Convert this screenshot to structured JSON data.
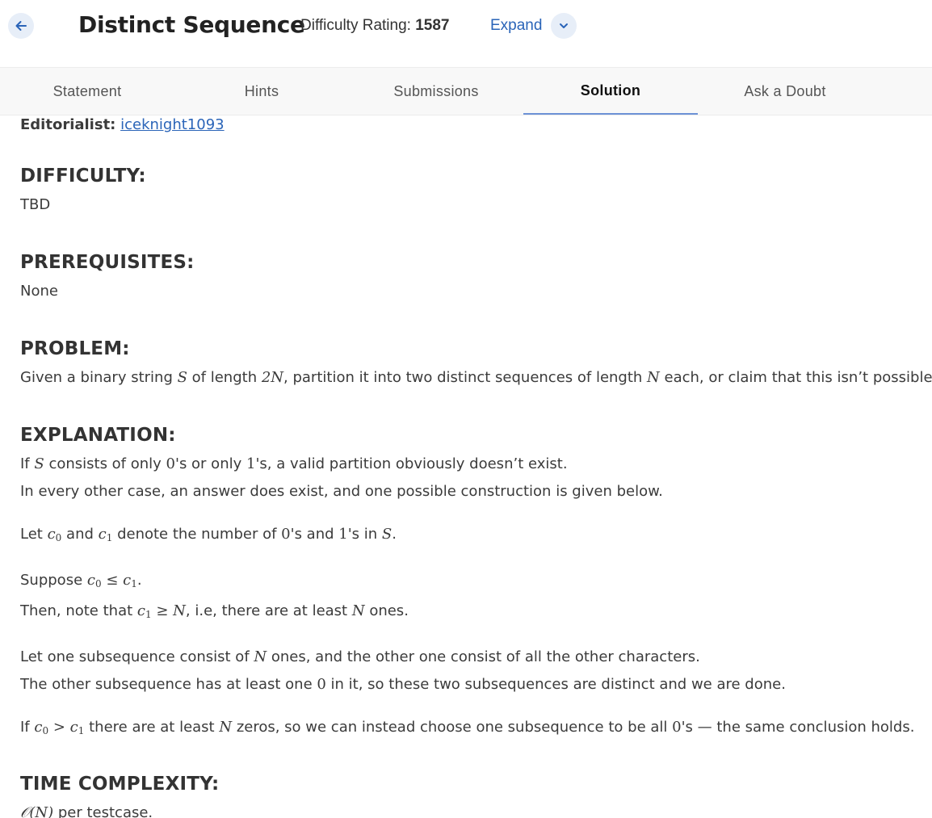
{
  "header": {
    "title": "Distinct Sequence",
    "rating_label": "Difficulty Rating: ",
    "rating_value": "1587",
    "expand_label": "Expand"
  },
  "tabs": [
    {
      "label": "Statement"
    },
    {
      "label": "Hints"
    },
    {
      "label": "Submissions"
    },
    {
      "label": "Solution",
      "active": true
    },
    {
      "label": "Ask a Doubt"
    }
  ],
  "editorial": {
    "editorialist_label": "Editorialist:",
    "editorialist_name": "iceknight1093",
    "difficulty_heading": "DIFFICULTY:",
    "difficulty_value": "TBD",
    "prereq_heading": "PREREQUISITES:",
    "prereq_value": "None",
    "problem_heading": "PROBLEM:",
    "explanation_heading": "EXPLANATION:",
    "time_heading": "TIME COMPLEXITY:",
    "problem_text": {
      "t1": "Given a binary string ",
      "m1": "S",
      "t2": " of length ",
      "m2": "2N",
      "t3": ", partition it into two distinct sequences of length ",
      "m3": "N",
      "t4": " each, or claim that this isn’t possible."
    },
    "expl_p1": {
      "t1": "If ",
      "m1": "S",
      "t2": " consists of only ",
      "m2": "0",
      "t3": "'s or only ",
      "m3": "1",
      "t4": "'s, a valid partition obviously doesn’t exist."
    },
    "expl_p2": "In every other case, an answer does exist, and one possible construction is given below.",
    "expl_p3": {
      "t1": "Let ",
      "m1": "c",
      "s1": "0",
      "t2": " and ",
      "m2": "c",
      "s2": "1",
      "t3": " denote the number of ",
      "m3": "0",
      "t4": "'s and ",
      "m4": "1",
      "t5": "'s in ",
      "m5": "S",
      "t6": "."
    },
    "expl_p4": {
      "t1": "Suppose ",
      "m1": "c",
      "s1": "0",
      "op": " ≤ ",
      "m2": "c",
      "s2": "1",
      "t2": "."
    },
    "expl_p5": {
      "t1": "Then, note that ",
      "m1": "c",
      "s1": "1",
      "op": " ≥ ",
      "m2": "N",
      "t2": ", i.e, there are at least ",
      "m3": "N",
      "t3": " ones."
    },
    "expl_p6": {
      "t1": "Let one subsequence consist of ",
      "m1": "N",
      "t2": " ones, and the other one consist of all the other characters."
    },
    "expl_p7": {
      "t1": "The other subsequence has at least one ",
      "m1": "0",
      "t2": " in it, so these two subsequences are distinct and we are done."
    },
    "expl_p8": {
      "t1": "If ",
      "m1": "c",
      "s1": "0",
      "op": " > ",
      "m2": "c",
      "s2": "1",
      "t2": " there are at least ",
      "m3": "N",
      "t3": " zeros, so we can instead choose one subsequence to be all ",
      "m4": "0",
      "t4": "'s — the same conclusion holds."
    },
    "time_text": {
      "m1": "𝒪(N)",
      "t1": " per testcase."
    }
  },
  "colors": {
    "accent": "#2a64b8",
    "tab_underline": "#6d92d6",
    "icon_bg": "#e7eef8"
  }
}
